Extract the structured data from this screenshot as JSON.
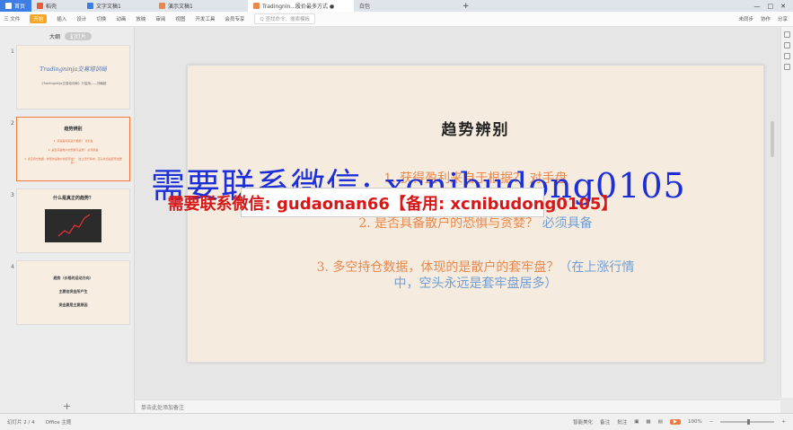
{
  "tabs": {
    "home": "首页",
    "a": "稻壳",
    "b": "文字文稿1",
    "c": "演示文稿1",
    "d": "Tradingnin...股价最多方式 ●",
    "e": "白包",
    "plus": "+"
  },
  "ribbon": {
    "file": "三 文件",
    "start": "开始",
    "insert": "插入",
    "design": "设计",
    "transition": "切换",
    "animation": "动画",
    "slideshow": "放映",
    "review": "审阅",
    "view": "视图",
    "devtools": "开发工具",
    "member": "会员专享",
    "search_placeholder": "Q 查找命令、搜索模板",
    "unsync": "未同步",
    "collab": "协作",
    "share": "分享"
  },
  "panel": {
    "outline": "大纲",
    "slides": "幻灯片",
    "add": "+"
  },
  "thumbs": [
    {
      "num": "1",
      "title": "Tradingninja交易培训局",
      "sub": "《Tradingninja交易培训局》介绍用——刘翰超"
    },
    {
      "num": "2",
      "title": "趋势辨别",
      "l1": "1. 获得盈利来自于根据？ 对手盘",
      "l2": "2. 是否具备散户的恐惧与贪婪？ 必须具备",
      "l3": "3. 多空持仓数据，体现的是散户的套牢盘？（在上涨行情中，空头永远是套牢盘居多）"
    },
    {
      "num": "3",
      "title": "什么是真正的趋势？"
    },
    {
      "num": "4",
      "l1": "趋势（价格的运动方向）",
      "l2": "主要由资金所产生",
      "l3": "资金要是主要原因"
    }
  ],
  "slide": {
    "title": "趋势辨别",
    "line1": "1. 获得盈利来自于根据？ 对手盘",
    "line2a": "2. 是否具备散户的恐惧与贪婪？",
    "line2b": " 必须具备",
    "line3a": "3. 多空持仓数据，体现的是散户的套牢盘？",
    "line3b": "（在上涨行情",
    "line3c": "中，空头永远是套牢盘居多）"
  },
  "watermark": {
    "big": "需要联系微信: xcnibudong0105",
    "box": "需要联系微信: gudaonan66【备用: xcnibudong0105】"
  },
  "notes": "单击此处添加备注",
  "status": {
    "page": "幻灯片 2 / 4",
    "theme": "Office 主题",
    "smart": "智能美化",
    "notes": "备注",
    "comment": "批注",
    "zoom": "100%"
  },
  "colors": {
    "accent": "#3c7de6",
    "orange": "#e8884c",
    "blue": "#6f9ed6"
  }
}
